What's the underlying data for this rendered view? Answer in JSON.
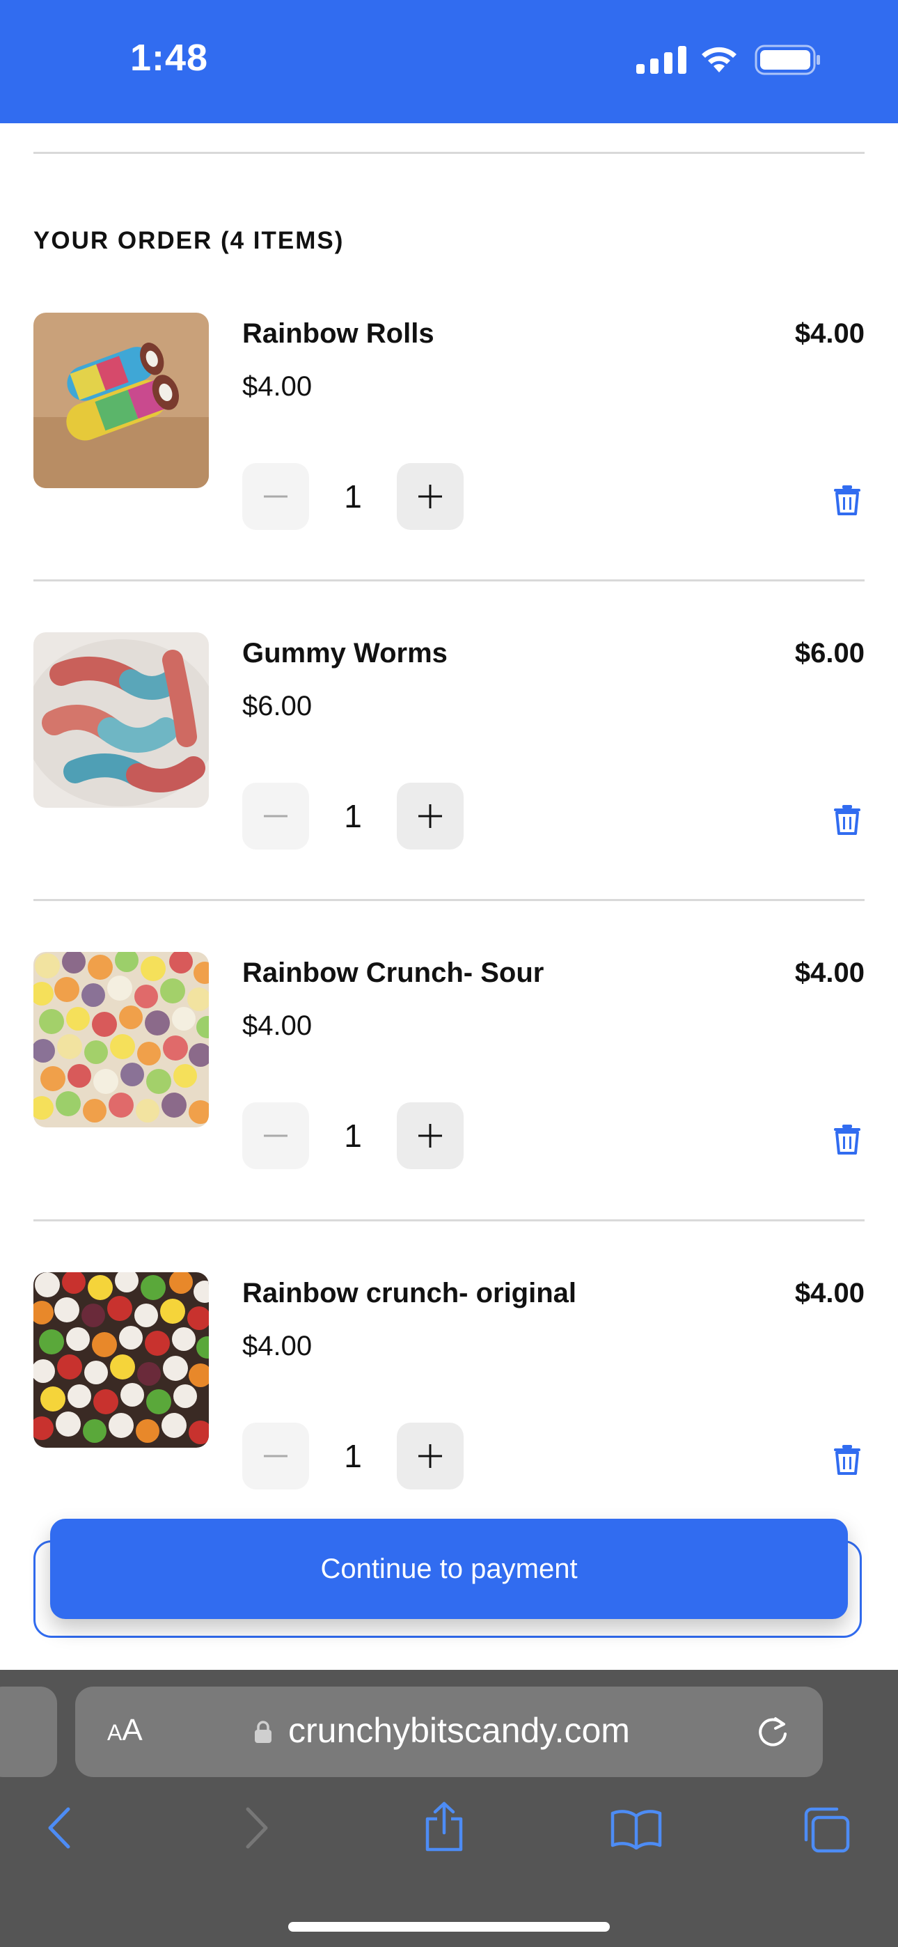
{
  "status_bar": {
    "time": "1:48",
    "icons": [
      "cellular-signal-icon",
      "wifi-icon",
      "battery-icon"
    ]
  },
  "order": {
    "title": "YOUR ORDER (4 ITEMS)",
    "items": [
      {
        "name": "Rainbow Rolls",
        "unit_price": "$4.00",
        "line_total": "$4.00",
        "quantity": "1"
      },
      {
        "name": "Gummy Worms",
        "unit_price": "$6.00",
        "line_total": "$6.00",
        "quantity": "1"
      },
      {
        "name": "Rainbow Crunch- Sour",
        "unit_price": "$4.00",
        "line_total": "$4.00",
        "quantity": "1"
      },
      {
        "name": "Rainbow crunch- original",
        "unit_price": "$4.00",
        "line_total": "$4.00",
        "quantity": "1"
      }
    ]
  },
  "checkout": {
    "button_label": "Continue to payment"
  },
  "browser": {
    "aa_small": "A",
    "aa_large": "A",
    "url": "crunchybitscandy.com"
  },
  "colors": {
    "accent": "#316cf0",
    "browser_chrome": "#555555",
    "url_field": "#7a7a7a"
  }
}
